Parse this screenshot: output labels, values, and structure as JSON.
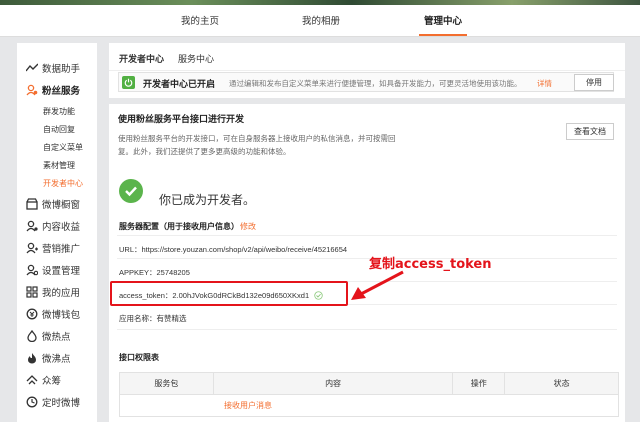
{
  "topnav": {
    "tabs": [
      {
        "label": "我的主页"
      },
      {
        "label": "我的相册"
      },
      {
        "label": "管理中心",
        "active": true
      }
    ],
    "accent": "#f36e2f"
  },
  "sidebar": {
    "items": [
      {
        "label": "数据助手",
        "icon": "trend-icon"
      },
      {
        "label": "粉丝服务",
        "icon": "fans-icon",
        "active": true
      },
      {
        "label": "微博橱窗",
        "icon": "store-icon"
      },
      {
        "label": "内容收益",
        "icon": "income-icon"
      },
      {
        "label": "营销推广",
        "icon": "promote-icon"
      },
      {
        "label": "设置管理",
        "icon": "settings-icon"
      },
      {
        "label": "我的应用",
        "icon": "apps-icon"
      },
      {
        "label": "微博钱包",
        "icon": "wallet-icon"
      },
      {
        "label": "微热点",
        "icon": "hotspot-icon"
      },
      {
        "label": "微沸点",
        "icon": "boil-icon"
      },
      {
        "label": "众筹",
        "icon": "crowdfund-icon"
      },
      {
        "label": "定时微博",
        "icon": "clock-icon"
      }
    ],
    "subitems": [
      {
        "label": "群发功能"
      },
      {
        "label": "自动回复"
      },
      {
        "label": "自定义菜单"
      },
      {
        "label": "素材管理"
      },
      {
        "label": "开发者中心",
        "active": true
      }
    ]
  },
  "devpanel": {
    "tabs": [
      {
        "label": "开发者中心",
        "active": true
      },
      {
        "label": "服务中心"
      }
    ],
    "status_title": "开发者中心已开启",
    "status_desc": "通过编辑和发布自定义菜单来进行便捷管理，如具备开发能力，可更灵活地使用该功能。",
    "status_more": "详情",
    "disable_button": "停用"
  },
  "platform": {
    "heading": "使用粉丝服务平台接口进行开发",
    "description": "使用粉丝服务平台的开发接口，可在自身服务器上接收用户的私信消息，并可按需回复。此外，我们还提供了更多更高级的功能和体验。",
    "doc_button": "查看文档",
    "dev_message": "你已成为开发者。",
    "config_title": "服务器配置（用于接收用户信息）",
    "config_edit": "修改",
    "url_label": "URL：",
    "url_value": "https://store.youzan.com/shop/v2/api/weibo/receive/45216654",
    "appkey_label": "APPKEY：",
    "appkey_value": "25748205",
    "token_label": "access_token：",
    "token_value": "2.00hJVokG0dRCkBd132e09d650XKxd1",
    "appname_label": "应用名称：",
    "appname_value": "有赞精选",
    "permissions_title": "接口权限表",
    "table_headers": [
      "服务包",
      "内容",
      "操作",
      "状态"
    ],
    "table_first_item": "接收用户消息"
  },
  "annotation": {
    "text": "复制access_token",
    "color": "#e4141b"
  }
}
